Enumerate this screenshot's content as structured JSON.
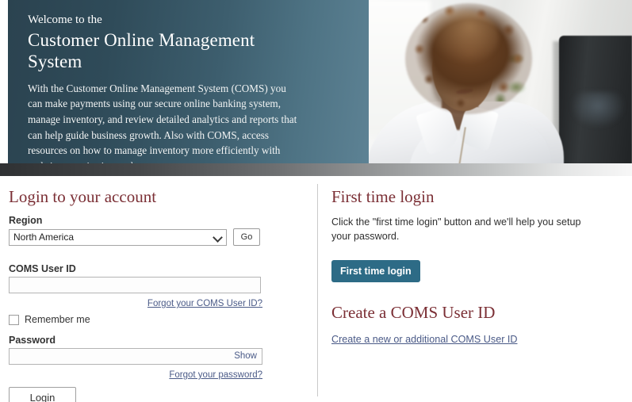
{
  "hero": {
    "welcome": "Welcome to the",
    "title": "Customer Online Management System",
    "body": "With the Customer Online Management System (COMS) you can make payments using our secure online banking system, manage inventory, and review detailed analytics and reports that can help guide business growth. Also with COMS, access resources on how to manage inventory more efficiently with real-time monitoring tools.",
    "photo_alt": "woman-at-computer-photo"
  },
  "login": {
    "heading": "Login to your account",
    "region_label": "Region",
    "region_value": "North America",
    "region_options": [
      "North America"
    ],
    "go_label": "Go",
    "userid_label": "COMS User ID",
    "userid_value": "",
    "userid_placeholder": "",
    "forgot_userid_link": "Forgot your COMS User ID?",
    "remember_label": "Remember me",
    "remember_checked": false,
    "password_label": "Password",
    "password_value": "",
    "password_placeholder": "",
    "show_label": "Show",
    "forgot_password_link": "Forgot your password?",
    "login_label": "Login"
  },
  "first_time": {
    "heading": "First time login",
    "body": "Click the \"first time login\" button and we'll help you setup your password.",
    "button_label": "First time login"
  },
  "create": {
    "heading": "Create a COMS User ID",
    "link": "Create a new or additional COMS User ID"
  },
  "colors": {
    "hero_dark": "#2b4350",
    "hero_light": "#5d8294",
    "heading_maroon": "#7b2f35",
    "accent_teal": "#2d6b86",
    "link_blue": "#4a5a87"
  }
}
